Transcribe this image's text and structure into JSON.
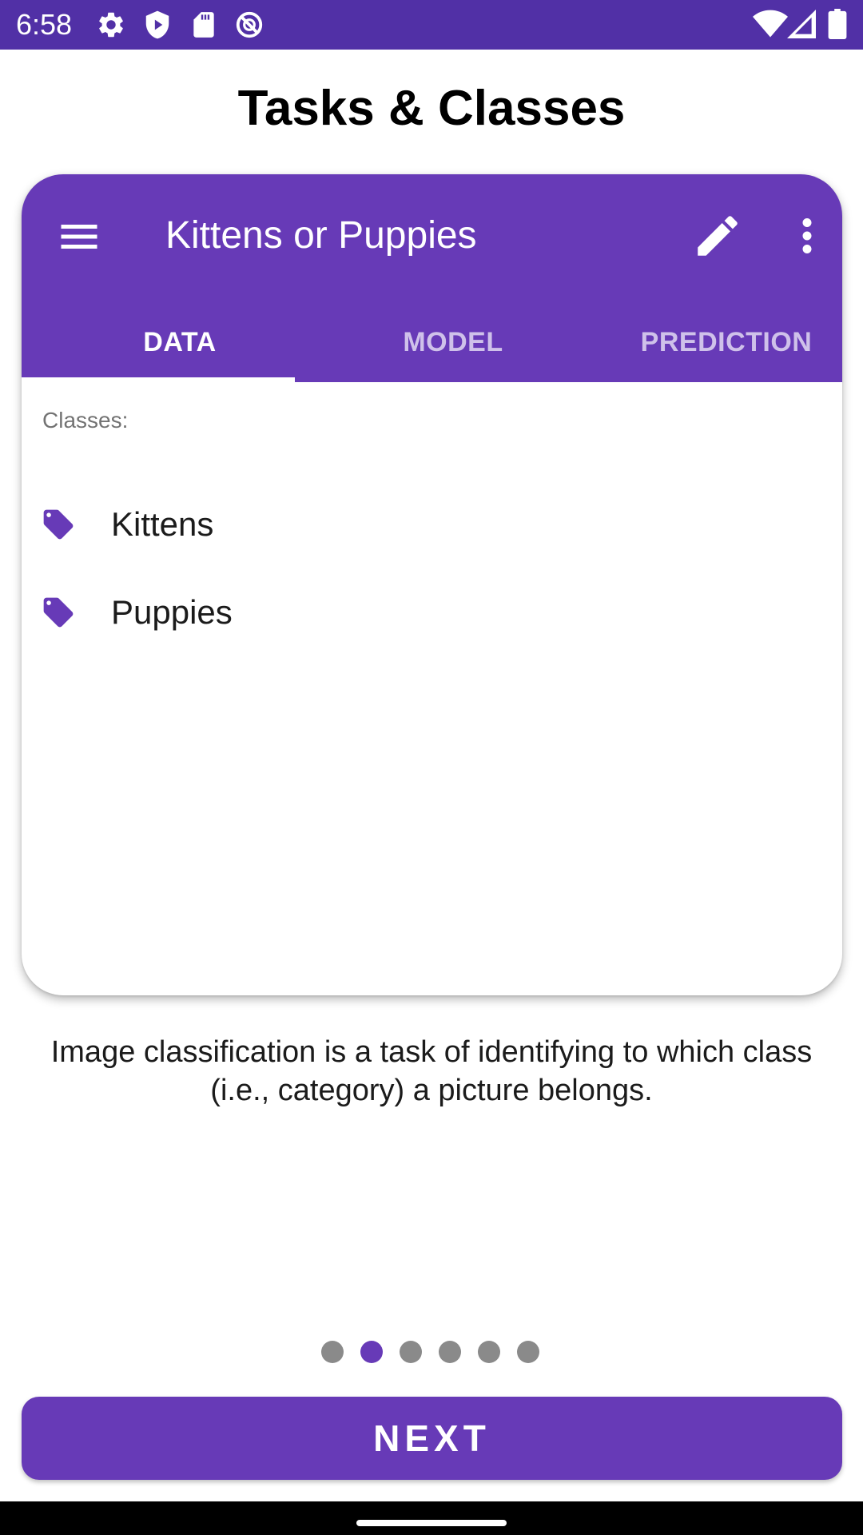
{
  "status_bar": {
    "time": "6:58",
    "background_color": "#5130a6",
    "icons": [
      "settings-icon",
      "shield-icon",
      "sd-card-icon",
      "do-not-disturb-icon",
      "wifi-icon",
      "signal-icon",
      "battery-icon"
    ]
  },
  "page": {
    "title": "Tasks & Classes"
  },
  "card": {
    "app_bar": {
      "title": "Kittens or Puppies",
      "background_color": "#673ab7",
      "icons": [
        "menu-icon",
        "edit-icon",
        "more-vert-icon"
      ]
    },
    "tabs": [
      {
        "label": "DATA",
        "active": true
      },
      {
        "label": "MODEL",
        "active": false
      },
      {
        "label": "PREDICTION",
        "active": false
      }
    ],
    "classes_label": "Classes:",
    "classes": [
      {
        "label": "Kittens",
        "icon": "tag-icon"
      },
      {
        "label": "Puppies",
        "icon": "tag-icon"
      }
    ]
  },
  "description": "Image classification is a task of identifying to which class (i.e., category) a picture belongs.",
  "pager": {
    "total_pages": 6,
    "current_page": 2
  },
  "next_button": {
    "label": "NEXT"
  },
  "colors": {
    "accent": "#673ab7",
    "dot_inactive": "#8a8a8a"
  }
}
